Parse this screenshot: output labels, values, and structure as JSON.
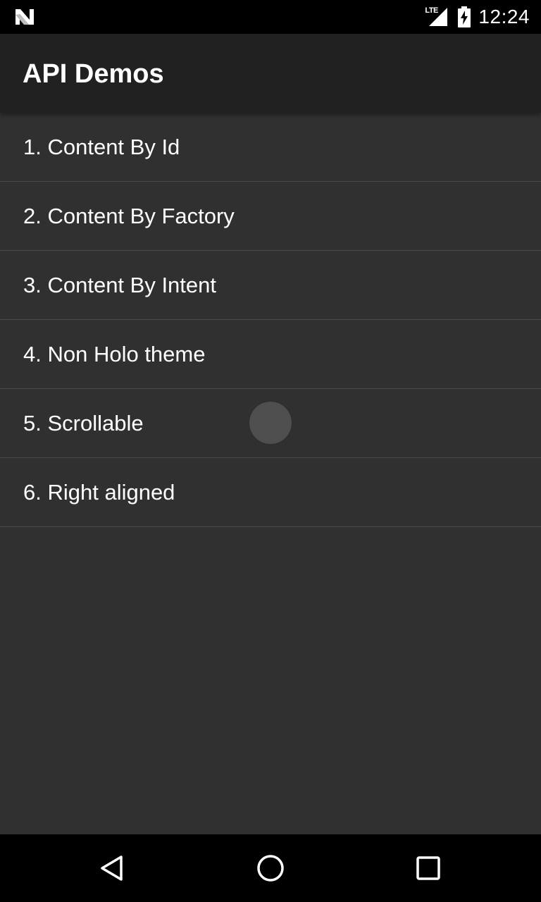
{
  "status_bar": {
    "time": "12:24",
    "network_label": "LTE",
    "icons": [
      "notification-n-icon",
      "lte-signal-icon",
      "battery-charging-icon"
    ]
  },
  "action_bar": {
    "title": "API Demos"
  },
  "list": {
    "items": [
      {
        "label": "1. Content By Id"
      },
      {
        "label": "2. Content By Factory"
      },
      {
        "label": "3. Content By Intent"
      },
      {
        "label": "4. Non Holo theme"
      },
      {
        "label": "5. Scrollable"
      },
      {
        "label": "6. Right aligned"
      }
    ]
  },
  "nav_bar": {
    "icons": [
      "back-icon",
      "home-icon",
      "recents-icon"
    ]
  },
  "colors": {
    "status_bar": "#000000",
    "action_bar": "#212121",
    "background": "#303030",
    "divider": "#4a4a4a",
    "text": "#ffffff"
  }
}
